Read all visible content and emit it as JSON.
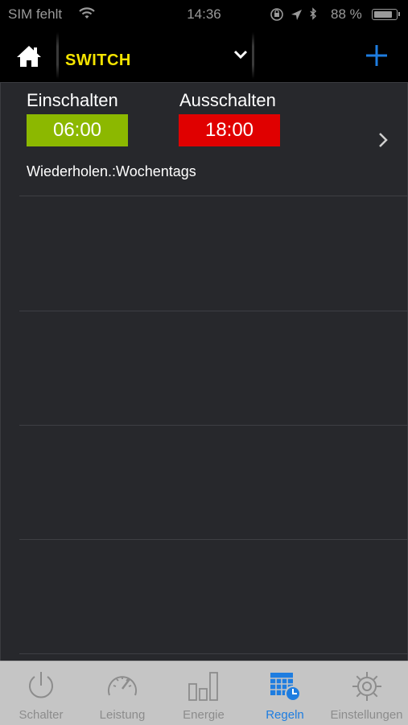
{
  "status_bar": {
    "carrier": "SIM fehlt",
    "time": "14:36",
    "battery_percent": "88 %",
    "battery_level": 0.88
  },
  "nav": {
    "title": "SWITCH",
    "title_color": "#f5e400",
    "accent": "#1e7de0"
  },
  "rule": {
    "on_label": "Einschalten",
    "on_time": "06:00",
    "on_color": "#8cb800",
    "off_label": "Ausschalten",
    "off_time": "18:00",
    "off_color": "#e00000",
    "repeat": "Wiederholen.:Wochentags"
  },
  "tabs": [
    {
      "label": "Schalter",
      "icon": "power-icon"
    },
    {
      "label": "Leistung",
      "icon": "gauge-icon"
    },
    {
      "label": "Energie",
      "icon": "bar-chart-icon"
    },
    {
      "label": "Regeln",
      "icon": "calendar-clock-icon",
      "active": true
    },
    {
      "label": "Einstellungen",
      "icon": "gear-icon"
    }
  ]
}
